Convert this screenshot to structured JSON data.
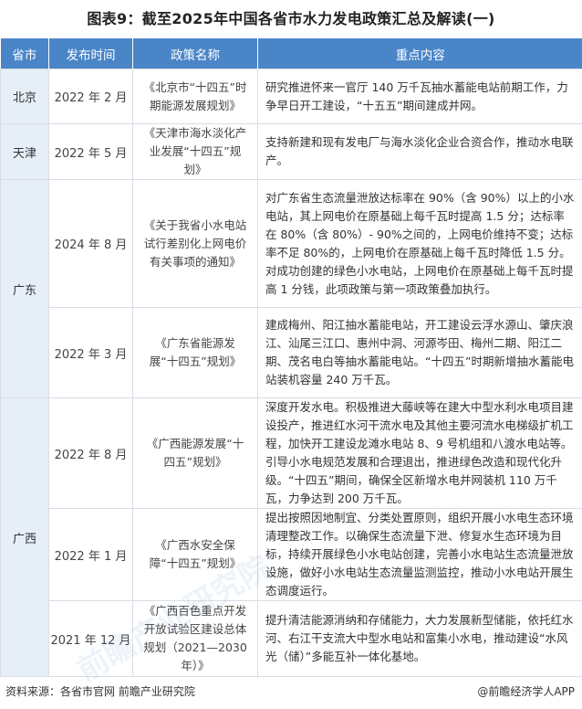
{
  "title": "图表9：截至2025年中国各省市水力发电政策汇总及解读(一)",
  "headers": {
    "province": "省市",
    "date": "发布时间",
    "policy": "政策名称",
    "content": "重点内容"
  },
  "provinces": [
    "北京",
    "天津",
    "广东",
    "广西"
  ],
  "rows": [
    {
      "date": "2022 年 2 月",
      "policy": "《北京市“十四五”时期能源发展规划》",
      "content": "研究推进怀来一官厅 140 万千瓦抽水蓄能电站前期工作，力争早日开工建设，“十五五”期间建成并网。"
    },
    {
      "date": "2022 年 5 月",
      "policy": "《天津市海水淡化产业发展“十四五”规划》",
      "content": "支持新建和现有发电厂与海水淡化企业合资合作，推动水电联产。"
    },
    {
      "date": "2024 年 8 月",
      "policy": "《关于我省小水电站试行差别化上网电价有关事项的通知》",
      "content": "对广东省生态流量泄放达标率在 90%（含 90%）以上的小水电站，其上网电价在原基础上每千瓦时提高 1.5 分；达标率在 80%（含 80%）- 90%之间的，上网电价维持不变；达标率不足 80%的，上网电价在原基础上每千瓦时降低 1.5 分。对成功创建的绿色小水电站，上网电价在原基础上每千瓦时提高 1 分钱，此项政策与第一项政策叠加执行。"
    },
    {
      "date": "2022 年 3 月",
      "policy": "《广东省能源发展“十四五”规划》",
      "content": "建成梅州、阳江抽水蓄能电站，开工建设云浮水源山、肇庆浪江、汕尾三江口、惠州中洞、河源岑田、梅州二期、阳江二期、茂名电白等抽水蓄能电站。“十四五”时期新增抽水蓄能电站装机容量 240 万千瓦。"
    },
    {
      "date": "2022 年 8 月",
      "policy": "《广西能源发展“十四五”规划》",
      "content": "深度开发水电。积极推进大藤峡等在建大中型水利水电项目建设投产，推进红水河干流水电及其他主要河流水电梯级扩机工程，加快开工建设龙滩水电站 8、9 号机组和八渡水电站等。引导小水电规范发展和合理退出，推进绿色改造和现代化升级。“十四五”期间，确保全区新增水电并网装机 110 万千瓦，力争达到 200 万千瓦。"
    },
    {
      "date": "2022 年 1 月",
      "policy": "《广西水安全保障“十四五”规划》",
      "content": "提出按照因地制宜、分类处置原则，组织开展小水电生态环境清理整改工作。以确保生态流量下泄、修复水生态环境为目标，持续开展绿色小水电站创建，完善小水电站生态流量泄放设施，做好小水电站生态流量监测监控，推动小水电站开展生态调度运行。"
    },
    {
      "date": "2021 年 12 月",
      "policy": "《广西百色重点开发开放试验区建设总体规划（2021—2030 年）》",
      "content": "提升清洁能源消纳和存储能力，大力发展新型储能，依托红水河、右江干支流大中型水电站和富集小水电，推动建设“水风光（储）”多能互补一体化基地。"
    }
  ],
  "footer": {
    "source": "资料来源：各省市官网 前瞻产业研究院",
    "brand": "@前瞻经济学人APP"
  },
  "watermark": "前瞻产业研究院",
  "colors": {
    "header_bg": "#4a85c8",
    "province_bg": "#e6eef8",
    "border": "#d8dee6"
  }
}
